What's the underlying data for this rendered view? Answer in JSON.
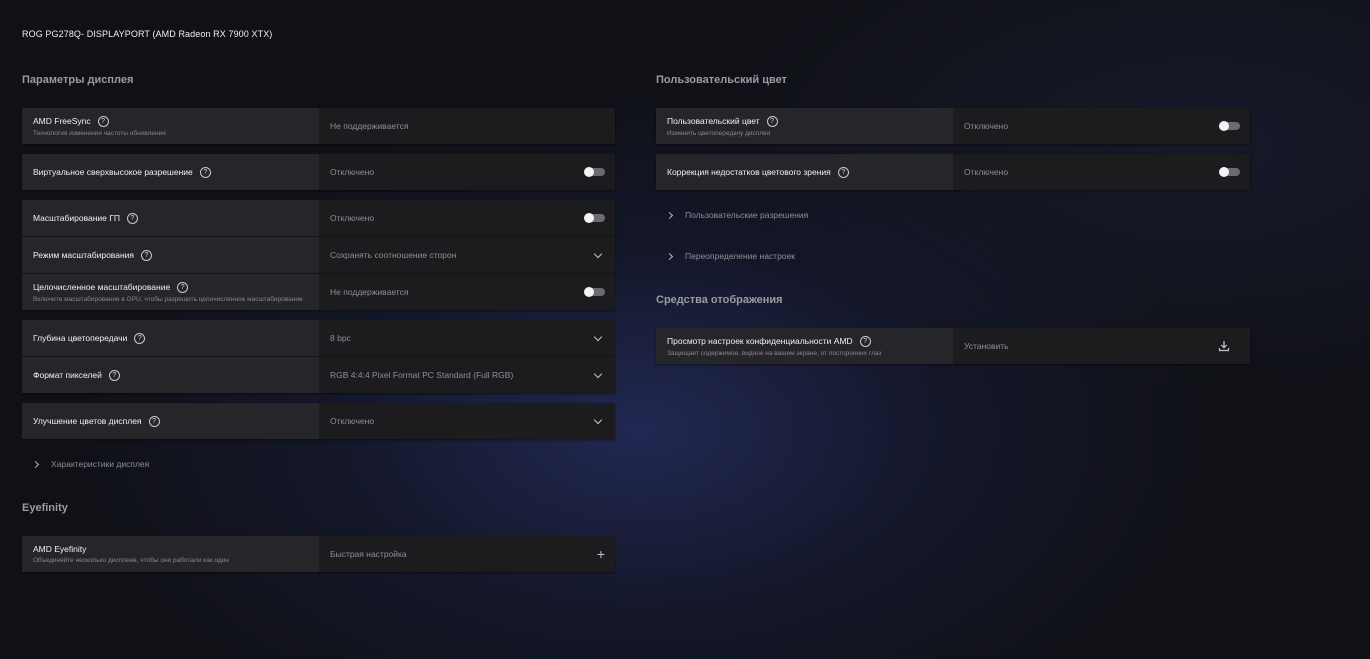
{
  "display_title": "ROG PG278Q- DISPLAYPORT (AMD Radeon RX 7900 XTX)",
  "sections": {
    "display_params": "Параметры дисплея",
    "eyefinity": "Eyefinity",
    "custom_color": "Пользовательский цвет",
    "display_tools": "Средства отображения"
  },
  "left": {
    "freesync": {
      "label": "AMD FreeSync",
      "sub": "Технология изменения частоты обновления",
      "value": "Не поддерживается"
    },
    "vsr": {
      "label": "Виртуальное сверхвысокое разрешение",
      "value": "Отключено"
    },
    "gpu_scaling": {
      "label": "Масштабирование ГП",
      "value": "Отключено"
    },
    "scaling_mode": {
      "label": "Режим масштабирования",
      "value": "Сохранять соотношение сторон"
    },
    "integer_scaling": {
      "label": "Целочисленное масштабирование",
      "sub": "Включите масштабирование в GPU, чтобы разрешить целочисленное масштабирование",
      "value": "Не поддерживается"
    },
    "color_depth": {
      "label": "Глубина цветопередачи",
      "value": "8 bpc"
    },
    "pixel_format": {
      "label": "Формат пикселей",
      "value": "RGB 4:4:4 Pixel Format PC Standard (Full RGB)"
    },
    "color_enhance": {
      "label": "Улучшение цветов дисплея",
      "value": "Отключено"
    },
    "display_specs": "Характеристики дисплея",
    "eyefinity": {
      "label": "AMD Eyefinity",
      "sub": "Объединяйте несколько дисплеев, чтобы они работали как один",
      "value": "Быстрая настройка"
    }
  },
  "right": {
    "custom_color": {
      "label": "Пользовательский цвет",
      "sub": "Изменить цветопередачу дисплея",
      "value": "Отключено"
    },
    "color_blind": {
      "label": "Коррекция недостатков цветового зрения",
      "value": "Отключено"
    },
    "custom_resolutions": "Пользовательские разрешения",
    "override": "Переопределение настроек",
    "privacy_view": {
      "label": "Просмотр настроек конфиденциальности AMD",
      "sub": "Защищает содержимое, видное на вашем экране, от посторонних глаз",
      "value": "Установить"
    }
  },
  "icons": {
    "help": "help-icon",
    "toggle": "toggle-switch",
    "dropdown": "chevron-down-icon",
    "plus": "plus-icon",
    "download": "download-icon",
    "expand": "chevron-right-icon"
  }
}
